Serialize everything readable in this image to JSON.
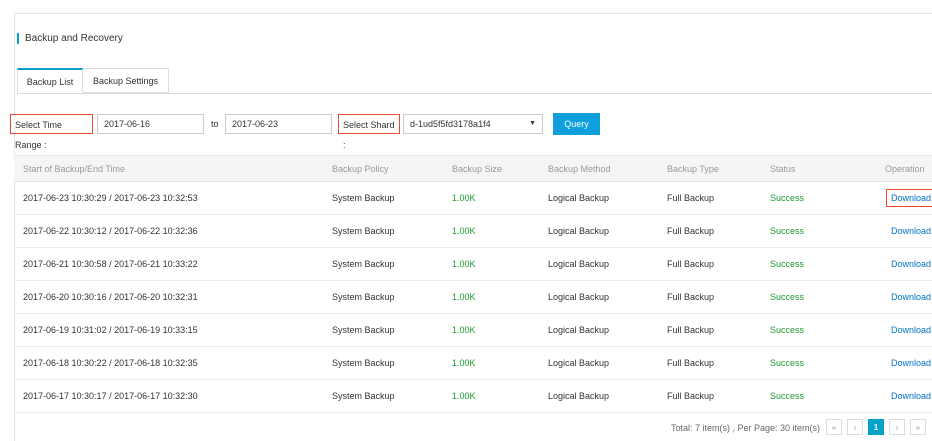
{
  "page": {
    "title": "Backup and Recovery"
  },
  "tabs": [
    {
      "label": "Backup List"
    },
    {
      "label": "Backup Settings"
    }
  ],
  "filters": {
    "time_range_label": "Select Time Range :",
    "start_date": "2017-06-16",
    "to_label": "to",
    "end_date": "2017-06-23",
    "shard_label": "Select Shard :",
    "shard_value": "d-1ud5f5fd3178a1f4",
    "query_label": "Query"
  },
  "table": {
    "headers": [
      "Start of Backup/End Time",
      "Backup Policy",
      "Backup Size",
      "Backup Method",
      "Backup Type",
      "Status",
      "Operation"
    ],
    "rows": [
      {
        "time": "2017-06-23 10:30:29 / 2017-06-23 10:32:53",
        "policy": "System Backup",
        "size": "1.00K",
        "method": "Logical Backup",
        "type": "Full Backup",
        "status": "Success",
        "op": "Download"
      },
      {
        "time": "2017-06-22 10:30:12 / 2017-06-22 10:32:36",
        "policy": "System Backup",
        "size": "1.00K",
        "method": "Logical Backup",
        "type": "Full Backup",
        "status": "Success",
        "op": "Download"
      },
      {
        "time": "2017-06-21 10:30:58 / 2017-06-21 10:33:22",
        "policy": "System Backup",
        "size": "1.00K",
        "method": "Logical Backup",
        "type": "Full Backup",
        "status": "Success",
        "op": "Download"
      },
      {
        "time": "2017-06-20 10:30:16 / 2017-06-20 10:32:31",
        "policy": "System Backup",
        "size": "1.00K",
        "method": "Logical Backup",
        "type": "Full Backup",
        "status": "Success",
        "op": "Download"
      },
      {
        "time": "2017-06-19 10:31:02 / 2017-06-19 10:33:15",
        "policy": "System Backup",
        "size": "1.00K",
        "method": "Logical Backup",
        "type": "Full Backup",
        "status": "Success",
        "op": "Download"
      },
      {
        "time": "2017-06-18 10:30:22 / 2017-06-18 10:32:35",
        "policy": "System Backup",
        "size": "1.00K",
        "method": "Logical Backup",
        "type": "Full Backup",
        "status": "Success",
        "op": "Download"
      },
      {
        "time": "2017-06-17 10:30:17 / 2017-06-17 10:32:30",
        "policy": "System Backup",
        "size": "1.00K",
        "method": "Logical Backup",
        "type": "Full Backup",
        "status": "Success",
        "op": "Download"
      }
    ]
  },
  "footer": {
    "total_text": "Total: 7 item(s) ,  Per Page: 30 item(s)",
    "pager": {
      "first": "«",
      "prev": "‹",
      "current": "1",
      "next": "›",
      "last": "»"
    }
  },
  "colors": {
    "accent": "#00a2ca",
    "query_button": "#0e9fdc",
    "success": "#1b9a2e",
    "link": "#0072c6",
    "highlight_border": "#e8492f"
  },
  "icons": {
    "select_caret": "caret-down-icon"
  }
}
